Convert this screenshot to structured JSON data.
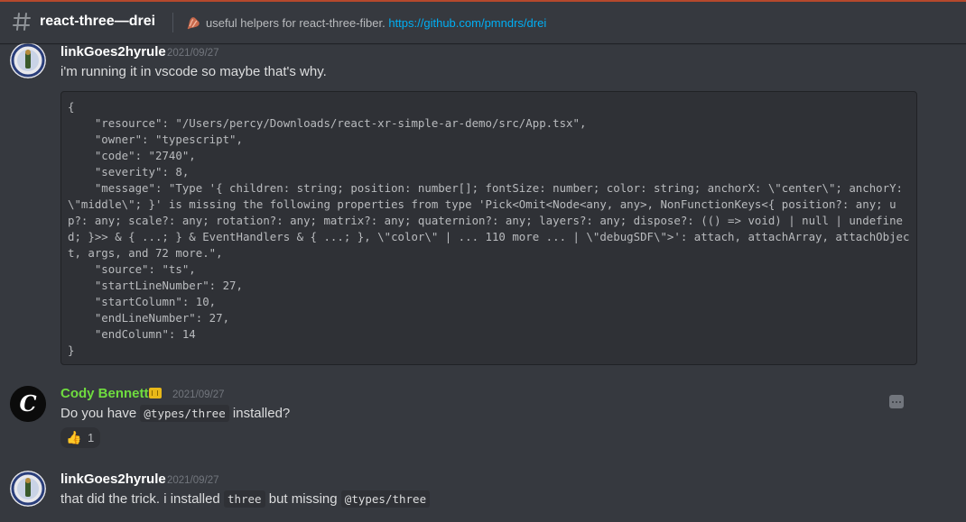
{
  "channel": {
    "name": "react-three—drei",
    "topic_text": "useful helpers for react-three-fiber.",
    "topic_link": "https://github.com/pmndrs/drei"
  },
  "messages": [
    {
      "author": "linkGoes2hyrule",
      "timestamp": "2021/09/27",
      "text": "i'm running it in vscode so maybe that's why.",
      "code": "{\n    \"resource\": \"/Users/percy/Downloads/react-xr-simple-ar-demo/src/App.tsx\",\n    \"owner\": \"typescript\",\n    \"code\": \"2740\",\n    \"severity\": 8,\n    \"message\": \"Type '{ children: string; position: number[]; fontSize: number; color: string; anchorX: \\\"center\\\"; anchorY: \\\"middle\\\"; }' is missing the following properties from type 'Pick<Omit<Node<any, any>, NonFunctionKeys<{ position?: any; up?: any; scale?: any; rotation?: any; matrix?: any; quaternion?: any; layers?: any; dispose?: (() => void) | null | undefined; }>> & { ...; } & EventHandlers & { ...; }, \\\"color\\\" | ... 110 more ... | \\\"debugSDF\\\">': attach, attachArray, attachObject, args, and 72 more.\",\n    \"source\": \"ts\",\n    \"startLineNumber\": 27,\n    \"startColumn\": 10,\n    \"endLineNumber\": 27,\n    \"endColumn\": 14\n}"
    },
    {
      "author": "Cody Bennett",
      "timestamp": "2021/09/27",
      "text_before": "Do you have",
      "code_inline": "@types/three",
      "text_after": "installed?",
      "reaction": {
        "emoji": "👍",
        "count": "1"
      }
    },
    {
      "author": "linkGoes2hyrule",
      "timestamp": "2021/09/27",
      "text_before": "that did the trick. i installed",
      "code_inline_1": "three",
      "text_middle": "but missing",
      "code_inline_2": "@types/three"
    }
  ],
  "colors": {
    "background": "#36393f",
    "codeblock": "#2f3136",
    "link": "#00aff4",
    "cody_name": "#6fdc3f",
    "badge": "#e8b818"
  },
  "icons": {
    "hash": "channel-hash-icon",
    "topic": "bacon-emoji-icon",
    "more": "more-options-icon",
    "badge": "gold-badge-icon"
  }
}
